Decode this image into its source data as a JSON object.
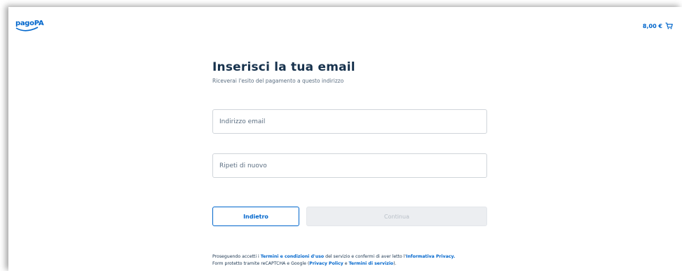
{
  "header": {
    "logo_text": "pagoPA",
    "cart_amount": "8,00 €",
    "cart_icon": "cart-icon"
  },
  "form": {
    "title": "Inserisci la tua email",
    "subtitle": "Riceverai l'esito del pagamento a questo indirizzo",
    "email_placeholder": "Indirizzo email",
    "repeat_placeholder": "Ripeti di nuovo",
    "back_label": "Indietro",
    "continue_label": "Continua"
  },
  "legal": {
    "line1_prefix": "Proseguendo accetti i ",
    "terms_link": "Termini e condizioni d'uso",
    "line1_middle": " del servizio e confermi di aver letto l'",
    "privacy_link": "Informativa Privacy.",
    "line2_prefix": "Form protetto tramite reCAPTCHA e Google (",
    "privacy_policy_link": "Privacy Policy",
    "line2_middle": " e ",
    "tos_link": "Termini di servizio",
    "line2_suffix": ")."
  },
  "colors": {
    "accent": "#0066cc",
    "title": "#17324d",
    "muted": "#5c6f82",
    "disabled_bg": "#eceef1"
  }
}
